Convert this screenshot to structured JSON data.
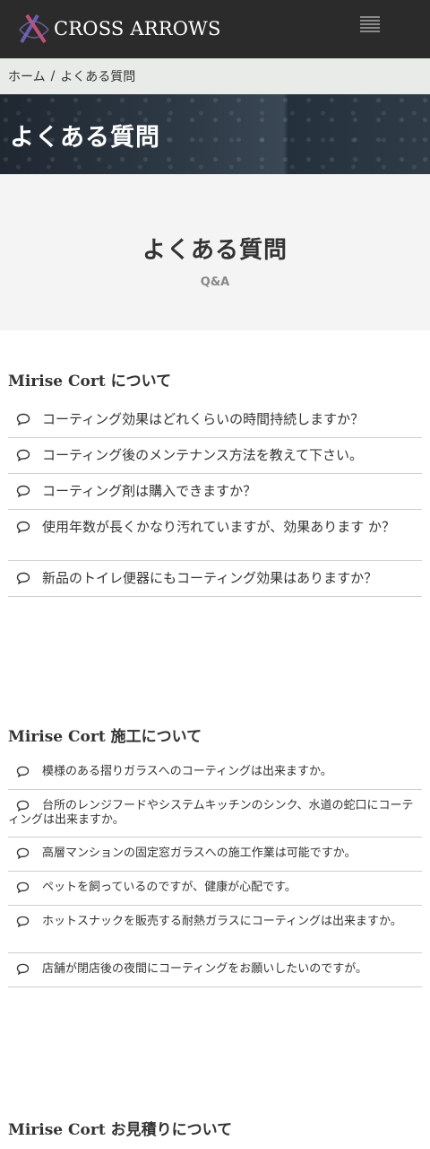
{
  "header": {
    "logo_text": "CROSS ARROWS"
  },
  "breadcrumb": {
    "home": "ホーム",
    "separator": "/",
    "current": "よくある質問"
  },
  "hero": {
    "title": "よくある質問"
  },
  "intro": {
    "title": "よくある質問",
    "subtitle": "Q&A"
  },
  "sections": [
    {
      "title": "Mirise Cort について",
      "items": [
        "コーティング効果はどれくらいの時間持続しますか？",
        "コーティング後のメンテナンス方法を教えて下さい。",
        "コーティング剤は購入できますか？",
        "使用年数が長くかなり汚れていますが、効果あります か？",
        "新品のトイレ便器にもコーティング効果はありますか？"
      ]
    },
    {
      "title": "Mirise Cort 施工について",
      "items": [
        "模様のある摺りガラスへのコーティングは出来ますか。",
        "台所のレンジフードやシステムキッチンのシンク、水道の蛇口にコーティングは出来ますか。",
        "高層マンションの固定窓ガラスへの施工作業は可能ですか。",
        "ペットを飼っているのですが、健康が心配です。",
        "ホットスナックを販売する耐熱ガラスにコーティングは出来ますか。",
        "店舗が閉店後の夜間にコーティングをお願いしたいのですが。"
      ]
    },
    {
      "title": "Mirise Cort お見積りについて"
    }
  ]
}
